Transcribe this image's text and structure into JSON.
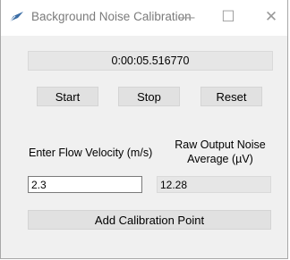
{
  "window": {
    "title": "Background Noise Calibration",
    "minimize_glyph": "—",
    "maximize_glyph": "☐",
    "close_glyph": "✕",
    "app_icon": "feather-icon"
  },
  "timer": {
    "value": "0:00:05.516770"
  },
  "controls": {
    "start_label": "Start",
    "stop_label": "Stop",
    "reset_label": "Reset"
  },
  "form": {
    "flow_label": "Enter Flow Velocity (m/s)",
    "flow_value": "2.3",
    "raw_label": "Raw Output Noise Average (µV)",
    "raw_value": "12.28"
  },
  "add_button_label": "Add Calibration Point",
  "colors": {
    "window_bg": "#f0f0f0",
    "titlebar_bg": "#ffffff",
    "button_bg": "#e1e1e1",
    "readonly_bg": "#e6e6e6",
    "icon_blue": "#3c6ea6"
  }
}
